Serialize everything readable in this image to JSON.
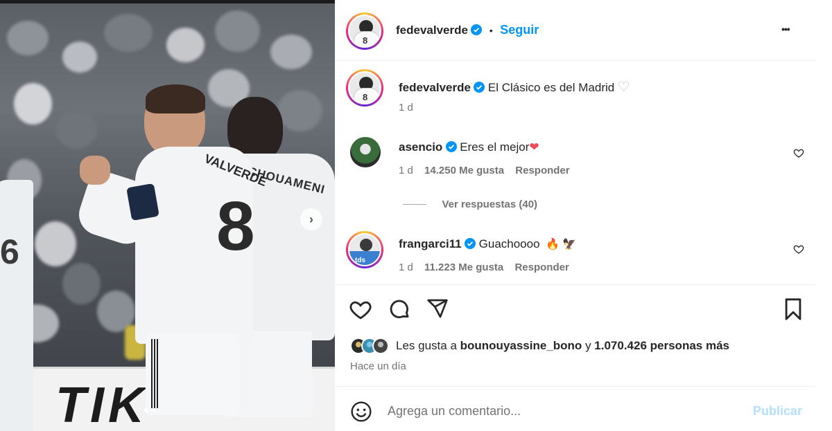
{
  "post": {
    "username": "fedevalverde",
    "dot": "•",
    "follow_label": "Seguir",
    "more_label": "•••",
    "caption": "El Clásico es del Madrid",
    "caption_emoji": "♡",
    "caption_age": "1 d"
  },
  "comments": [
    {
      "username": "asencio",
      "text": "Eres el mejor",
      "emoji": "❤",
      "age": "1 d",
      "likes": "14.250 Me gusta",
      "reply": "Responder",
      "view_replies": "Ver respuestas (40)"
    },
    {
      "username": "frangarci11",
      "text": "Guachoooo",
      "emoji": "🔥 🦅",
      "age": "1 d",
      "likes": "11.223 Me gusta",
      "reply": "Responder"
    }
  ],
  "likes_summary": {
    "prefix": "Les gusta a",
    "user": "bounouyassine_bono",
    "connector": "y",
    "count": "1.070.426 personas más"
  },
  "posted": "Hace un día",
  "composer": {
    "placeholder": "Agrega un comentario...",
    "publish_label": "Publicar"
  },
  "photo": {
    "jersey_number": "8",
    "jersey_name": "VALVERDE",
    "second_name": "TCHOUAMENI",
    "ad_text": "TIK"
  },
  "icons": [
    "heart-icon",
    "comment-icon",
    "share-icon",
    "bookmark-icon",
    "emoji-icon",
    "verified-icon",
    "more-icon",
    "chevron-right-icon"
  ],
  "colors": {
    "link": "#0095f6",
    "verified": "#0095f6",
    "publish_disabled": "#b2dffc",
    "heart_red": "#ed4956"
  }
}
